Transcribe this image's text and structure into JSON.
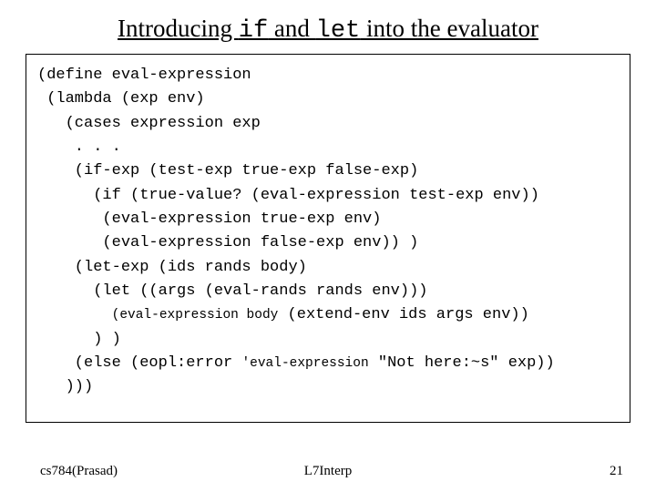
{
  "title": {
    "pre": "Introducing ",
    "kw1": "if",
    "mid": " and ",
    "kw2": "let",
    "post": "  into the evaluator"
  },
  "code": {
    "l1": "(define eval-expression",
    "l2": " (lambda (exp env)",
    "l3": "   (cases expression exp",
    "l4": "    . . .   ",
    "l5": "    (if-exp (test-exp true-exp false-exp)",
    "l6": "      (if (true-value? (eval-expression test-exp env))",
    "l7": "       (eval-expression true-exp env)",
    "l8": "       (eval-expression false-exp env)) )",
    "l9": "    (let-exp (ids rands body)",
    "l10": "      (let ((args (eval-rands rands env)))",
    "l11a": "        ",
    "l11b": "(eval-expression body",
    "l11c": " (extend-env ids args env))",
    "l12": "      ) )",
    "l13a": "    (else (eopl:error ",
    "l13b": "'eval-expression",
    "l13c": " \"Not here:~s\" exp))",
    "l14": "   )))"
  },
  "footer": {
    "left": "cs784(Prasad)",
    "center": "L7Interp",
    "right": "21"
  }
}
